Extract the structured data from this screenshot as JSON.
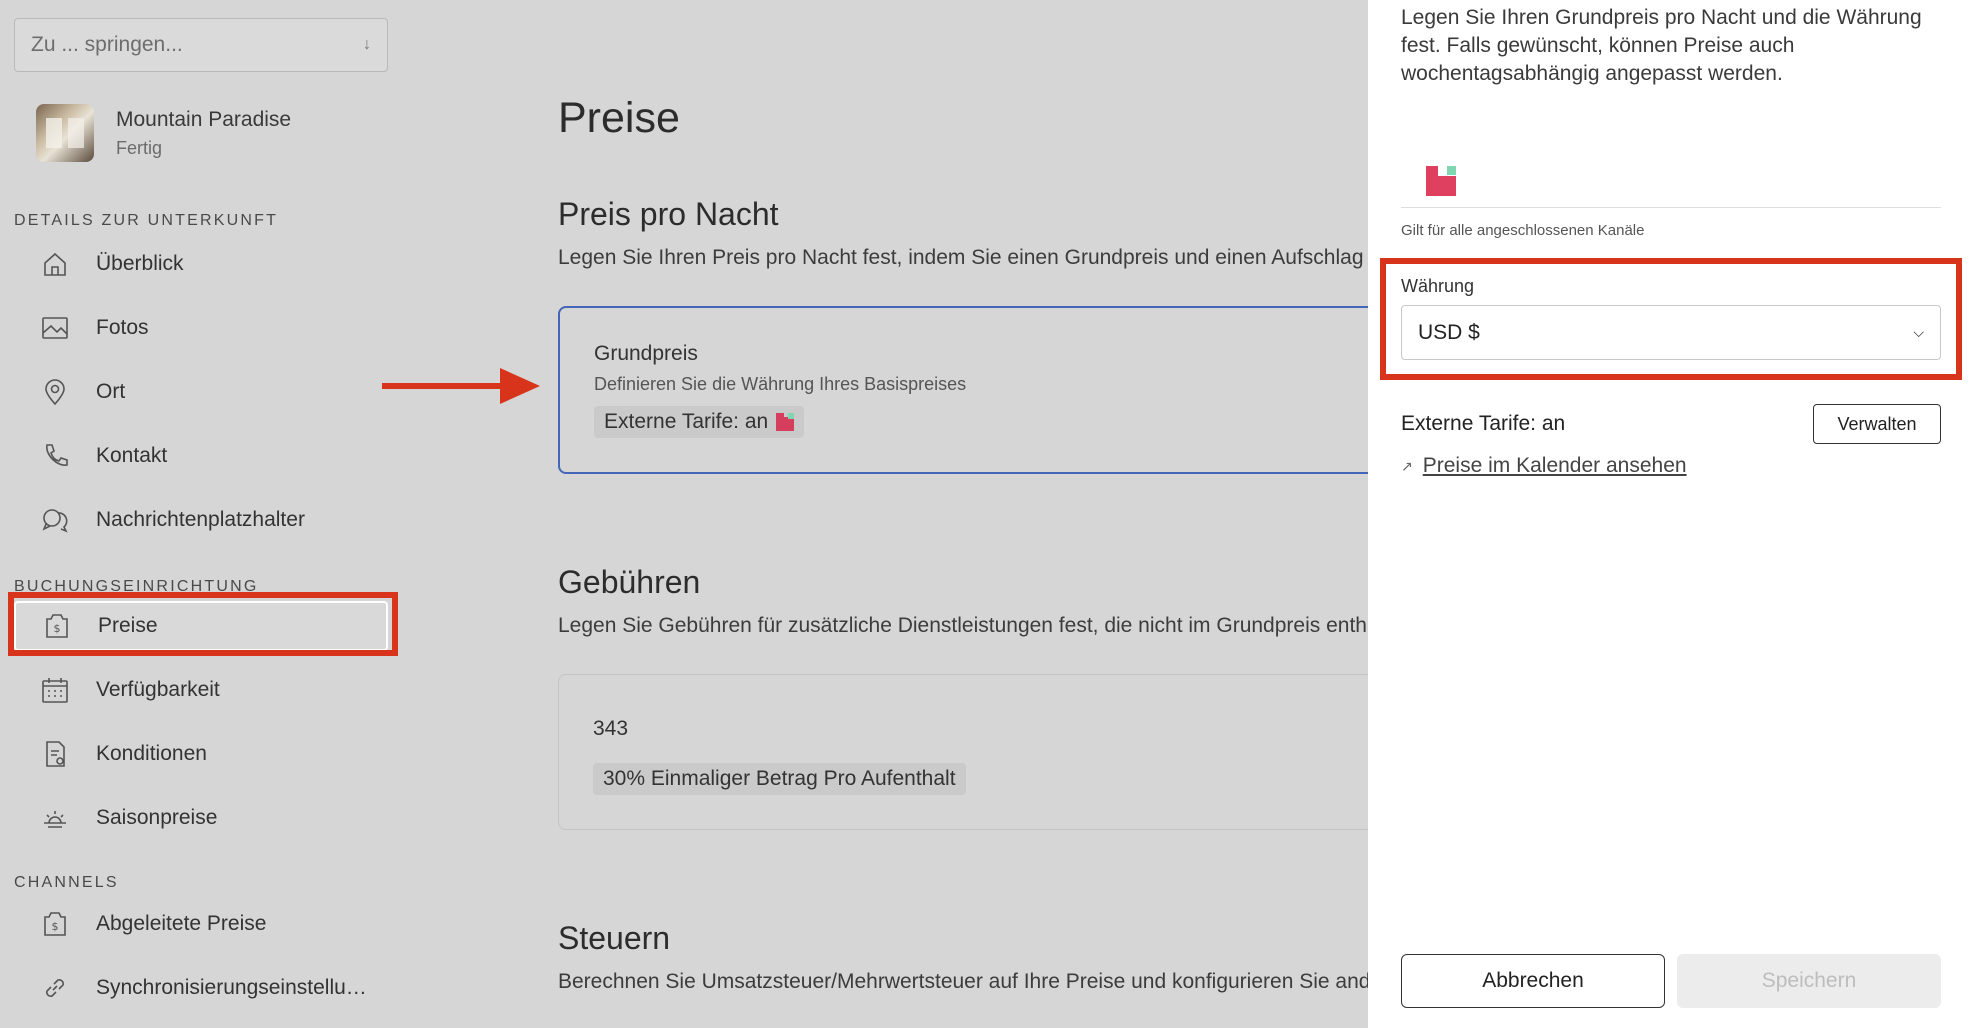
{
  "sidebar": {
    "jump_placeholder": "Zu ... springen...",
    "property": {
      "name": "Mountain Paradise",
      "status": "Fertig"
    },
    "sections": {
      "details": "DETAILS ZUR UNTERKUNFT",
      "booking": "BUCHUNGSEINRICHTUNG",
      "channels": "CHANNELS"
    },
    "items": [
      {
        "label": "Überblick",
        "icon": "home-icon"
      },
      {
        "label": "Fotos",
        "icon": "image-icon"
      },
      {
        "label": "Ort",
        "icon": "location-pin-icon"
      },
      {
        "label": "Kontakt",
        "icon": "phone-icon"
      },
      {
        "label": "Nachrichtenplatzhalter",
        "icon": "chat-bubbles-icon"
      },
      {
        "label": "Preise",
        "icon": "price-tag-icon",
        "active": true
      },
      {
        "label": "Verfügbarkeit",
        "icon": "calendar-icon"
      },
      {
        "label": "Konditionen",
        "icon": "document-icon"
      },
      {
        "label": "Saisonpreise",
        "icon": "sun-icon"
      },
      {
        "label": "Abgeleitete Preise",
        "icon": "price-tag-icon"
      },
      {
        "label": "Synchronisierungseinstellu…",
        "icon": "link-icon"
      }
    ]
  },
  "main": {
    "title": "Preise",
    "per_night": {
      "heading": "Preis pro Nacht",
      "text": "Legen Sie Ihren Preis pro Nacht fest, indem Sie einen Grundpreis und einen Aufschlag hin",
      "card": {
        "title": "Grundpreis",
        "subtitle": "Definieren Sie die Währung Ihres Basispreises",
        "pill": "Externe Tarife: an"
      }
    },
    "fees": {
      "heading": "Gebühren",
      "text": "Legen Sie Gebühren für zusätzliche Dienstleistungen fest, die nicht im Grundpreis enthalt",
      "card": {
        "value": "343",
        "pill": "30% Einmaliger Betrag Pro Aufenthalt"
      }
    },
    "taxes": {
      "heading": "Steuern",
      "text": "Berechnen Sie Umsatzsteuer/Mehrwertsteuer auf Ihre Preise und konfigurieren Sie ander"
    }
  },
  "panel": {
    "description": "Legen Sie Ihren Grundpreis pro Nacht und die Währung fest. Falls gewünscht, können Preise auch wochentagsabhängig angepasst werden.",
    "applies_note": "Gilt für alle angeschlossenen Kanäle",
    "currency_label": "Währung",
    "currency_value": "USD $",
    "external_rates": "Externe Tarife: an",
    "manage_button": "Verwalten",
    "calendar_link": "Preise im Kalender ansehen",
    "cancel_button": "Abbrechen",
    "save_button": "Speichern"
  },
  "colors": {
    "highlight": "#d8341b",
    "card_border": "#4466b8",
    "brand": "#e0405f",
    "brand_accent": "#7fd6b0"
  }
}
